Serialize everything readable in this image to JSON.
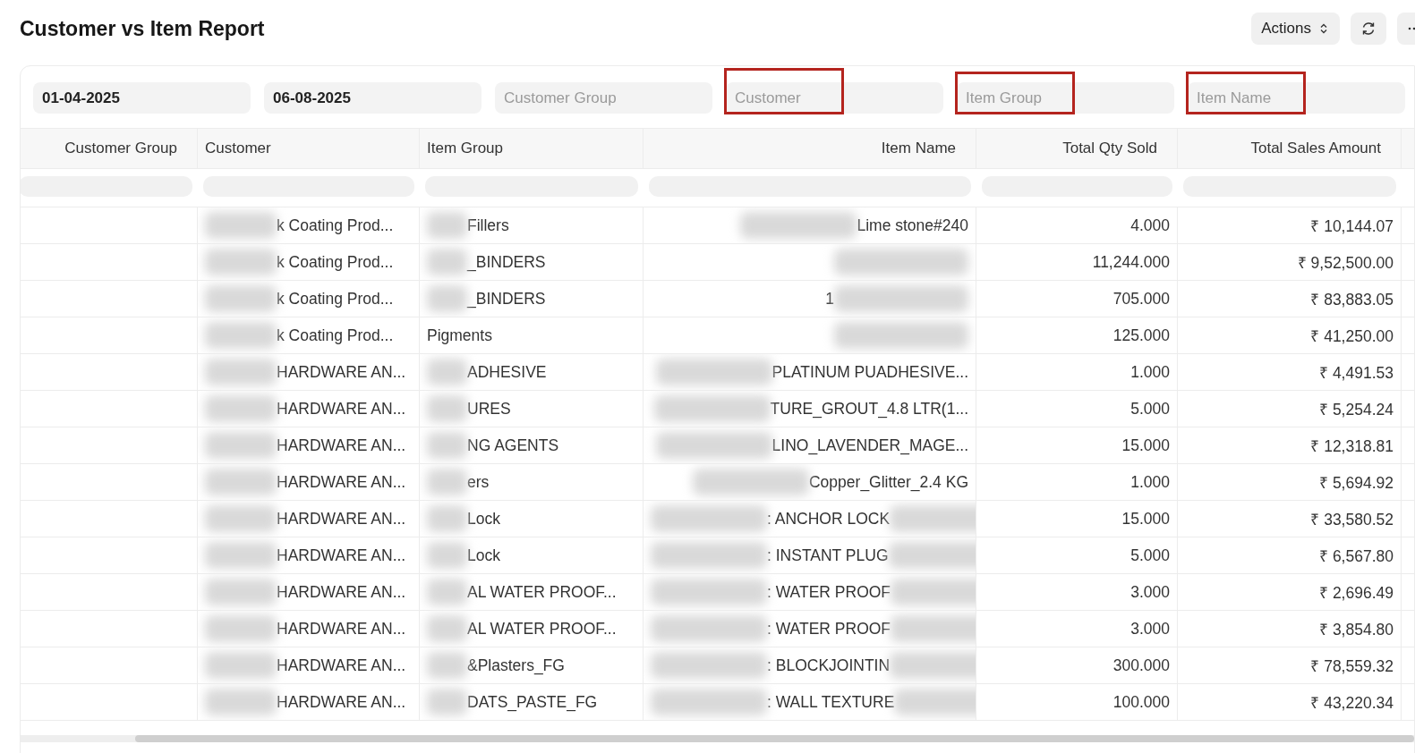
{
  "title": "Customer vs Item Report",
  "actions": {
    "label": "Actions"
  },
  "filters": [
    {
      "value": "01-04-2025",
      "annotated": false
    },
    {
      "value": "06-08-2025",
      "annotated": false
    },
    {
      "placeholder": "Customer Group",
      "annotated": false
    },
    {
      "placeholder": "Customer",
      "annotated": true
    },
    {
      "placeholder": "Item Group",
      "annotated": true
    },
    {
      "placeholder": "Item Name",
      "annotated": true
    }
  ],
  "table": {
    "columns": [
      "Customer Group",
      "Customer",
      "Item Group",
      "Item Name",
      "Total Qty Sold",
      "Total Sales Amount"
    ],
    "rows": [
      {
        "customer": {
          "text": "k Coating Prod...",
          "blur_before": true,
          "blur_after": false
        },
        "item_group": {
          "text": "Fillers",
          "blur_before": true,
          "blur_after": false
        },
        "item_name": {
          "text": "Lime stone#240",
          "blur_before": true,
          "blur_after": false
        },
        "qty": "4.000",
        "amount": "₹ 10,144.07"
      },
      {
        "customer": {
          "text": "k Coating Prod...",
          "blur_before": true,
          "blur_after": false
        },
        "item_group": {
          "text": "_BINDERS",
          "blur_before": true,
          "blur_after": false
        },
        "item_name": {
          "blur_before": false,
          "blur_after": true
        },
        "qty": "11,244.000",
        "amount": "₹ 9,52,500.00"
      },
      {
        "customer": {
          "text": "k Coating Prod...",
          "blur_before": true,
          "blur_after": false
        },
        "item_group": {
          "text": "_BINDERS",
          "blur_before": true,
          "blur_after": false
        },
        "item_name": {
          "text": "1",
          "blur_before": false,
          "blur_after": true
        },
        "qty": "705.000",
        "amount": "₹ 83,883.05"
      },
      {
        "customer": {
          "text": "k Coating Prod...",
          "blur_before": true,
          "blur_after": false
        },
        "item_group": {
          "text": "Pigments",
          "blur_before": false,
          "blur_after": false
        },
        "item_name": {
          "blur_before": false,
          "blur_after": true
        },
        "qty": "125.000",
        "amount": "₹ 41,250.00"
      },
      {
        "customer": {
          "text": "HARDWARE AN...",
          "blur_before": true,
          "blur_after": false
        },
        "item_group": {
          "text": "ADHESIVE",
          "blur_before": true,
          "blur_after": false
        },
        "item_name": {
          "text": "PLATINUM PUADHESIVE...",
          "blur_before": true,
          "blur_after": false
        },
        "qty": "1.000",
        "amount": "₹ 4,491.53"
      },
      {
        "customer": {
          "text": "HARDWARE AN...",
          "blur_before": true,
          "blur_after": false
        },
        "item_group": {
          "text": "URES",
          "blur_before": true,
          "blur_after": false
        },
        "item_name": {
          "text": "TURE_GROUT_4.8 LTR(1...",
          "blur_before": true,
          "blur_after": false
        },
        "qty": "5.000",
        "amount": "₹ 5,254.24"
      },
      {
        "customer": {
          "text": "HARDWARE AN...",
          "blur_before": true,
          "blur_after": false
        },
        "item_group": {
          "text": "NG AGENTS",
          "blur_before": true,
          "blur_after": false
        },
        "item_name": {
          "text": "LINO_LAVENDER_MAGE...",
          "blur_before": true,
          "blur_after": false
        },
        "qty": "15.000",
        "amount": "₹ 12,318.81"
      },
      {
        "customer": {
          "text": "HARDWARE AN...",
          "blur_before": true,
          "blur_after": false
        },
        "item_group": {
          "text": "ers",
          "blur_before": true,
          "blur_after": false
        },
        "item_name": {
          "text": "Copper_Glitter_2.4 KG",
          "blur_before": true,
          "blur_after": false
        },
        "qty": "1.000",
        "amount": "₹ 5,694.92"
      },
      {
        "customer": {
          "text": "HARDWARE AN...",
          "blur_before": true,
          "blur_after": false
        },
        "item_group": {
          "text": "Lock",
          "blur_before": true,
          "blur_after": false
        },
        "item_name": {
          "text": ": ANCHOR LOCK",
          "blur_before": true,
          "blur_after": true
        },
        "qty": "15.000",
        "amount": "₹ 33,580.52"
      },
      {
        "customer": {
          "text": "HARDWARE AN...",
          "blur_before": true,
          "blur_after": false
        },
        "item_group": {
          "text": "Lock",
          "blur_before": true,
          "blur_after": false
        },
        "item_name": {
          "text": ": INSTANT PLUG",
          "blur_before": true,
          "blur_after": true
        },
        "qty": "5.000",
        "amount": "₹ 6,567.80"
      },
      {
        "customer": {
          "text": "HARDWARE AN...",
          "blur_before": true,
          "blur_after": false
        },
        "item_group": {
          "text": "AL WATER PROOF...",
          "blur_before": true,
          "blur_after": false
        },
        "item_name": {
          "text": ": WATER PROOF",
          "blur_before": true,
          "blur_after": true
        },
        "qty": "3.000",
        "amount": "₹ 2,696.49"
      },
      {
        "customer": {
          "text": "HARDWARE AN...",
          "blur_before": true,
          "blur_after": false
        },
        "item_group": {
          "text": "AL WATER PROOF...",
          "blur_before": true,
          "blur_after": false
        },
        "item_name": {
          "text": ": WATER PROOF",
          "blur_before": true,
          "blur_after": true
        },
        "qty": "3.000",
        "amount": "₹ 3,854.80"
      },
      {
        "customer": {
          "text": "HARDWARE AN...",
          "blur_before": true,
          "blur_after": false
        },
        "item_group": {
          "text": "&Plasters_FG",
          "blur_before": true,
          "blur_after": false
        },
        "item_name": {
          "text": ": BLOCKJOINTIN",
          "blur_before": true,
          "blur_after": true
        },
        "qty": "300.000",
        "amount": "₹ 78,559.32"
      },
      {
        "customer": {
          "text": "HARDWARE AN...",
          "blur_before": true,
          "blur_after": false
        },
        "item_group": {
          "text": "DATS_PASTE_FG",
          "blur_before": true,
          "blur_after": false
        },
        "item_name": {
          "text": ": WALL TEXTURE",
          "blur_before": true,
          "blur_after": true
        },
        "qty": "100.000",
        "amount": "₹ 43,220.34"
      }
    ]
  }
}
